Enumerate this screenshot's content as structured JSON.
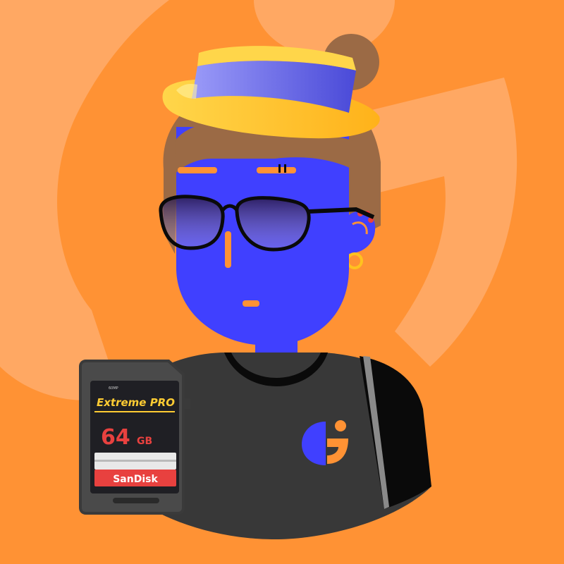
{
  "scene": {
    "background_color": "#ff9234",
    "background_logo_color": "#ffa863",
    "skin_color": "#4040ff",
    "hair_color": "#9b6a45",
    "hat_straw_color": "#ffc21f",
    "hat_band_color": "#6a6aee",
    "shirt_color": "#383838",
    "accent_color": "#ff9234"
  },
  "sd_card": {
    "series": "Extreme PRO",
    "capacity_value": "64",
    "capacity_unit": "GB",
    "brand": "SanDisk",
    "fine_print": "60MP",
    "label_color": "#1f1f24",
    "title_color": "#ffcc33",
    "capacity_color": "#e8413f",
    "brand_bar_color": "#e8413f"
  },
  "shirt_logo": {
    "icon": "brand-g-logo-icon",
    "colors": [
      "#4040ff",
      "#ff9234"
    ]
  }
}
